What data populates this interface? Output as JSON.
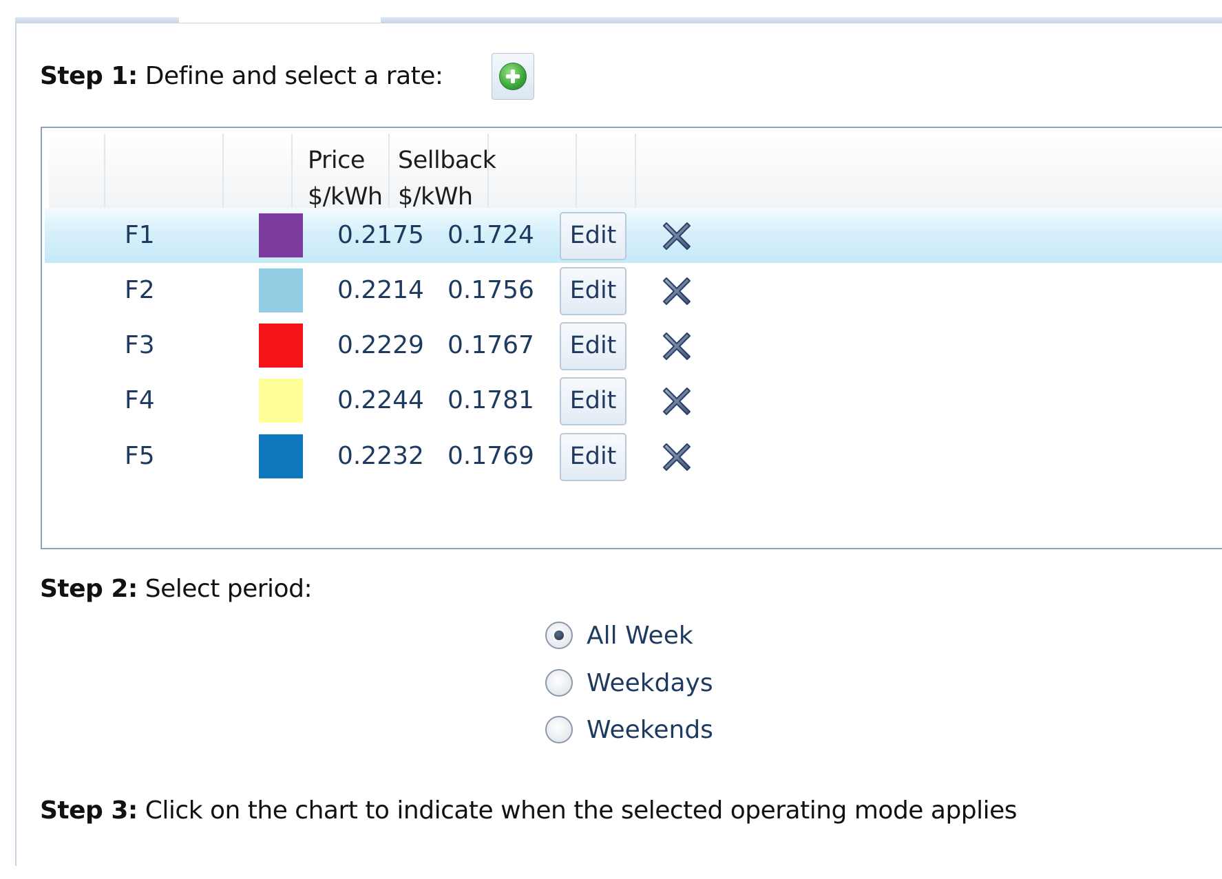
{
  "step1": {
    "label": "Step 1:",
    "text": " Define and select a rate:"
  },
  "step2": {
    "label": "Step 2:",
    "text": " Select period:"
  },
  "step3": {
    "label": "Step 3:",
    "text": " Click on the chart to indicate when the selected operating mode applies"
  },
  "add_button_icon": "add-circle-icon",
  "grid": {
    "columns": {
      "price": "Price\n$/kWh",
      "sellback": "Sellback\n$/kWh"
    },
    "rows": [
      {
        "name": "F1",
        "color": "#7b3a9e",
        "price": "0.2175",
        "sellback": "0.1724",
        "edit": "Edit",
        "selected": true
      },
      {
        "name": "F2",
        "color": "#92cde3",
        "price": "0.2214",
        "sellback": "0.1756",
        "edit": "Edit",
        "selected": false
      },
      {
        "name": "F3",
        "color": "#f5141a",
        "price": "0.2229",
        "sellback": "0.1767",
        "edit": "Edit",
        "selected": false
      },
      {
        "name": "F4",
        "color": "#ffff9a",
        "price": "0.2244",
        "sellback": "0.1781",
        "edit": "Edit",
        "selected": false
      },
      {
        "name": "F5",
        "color": "#0f78bd",
        "price": "0.2232",
        "sellback": "0.1769",
        "edit": "Edit",
        "selected": false
      }
    ]
  },
  "period": {
    "options": [
      {
        "label": "All Week",
        "checked": true
      },
      {
        "label": "Weekdays",
        "checked": false
      },
      {
        "label": "Weekends",
        "checked": false
      }
    ]
  }
}
